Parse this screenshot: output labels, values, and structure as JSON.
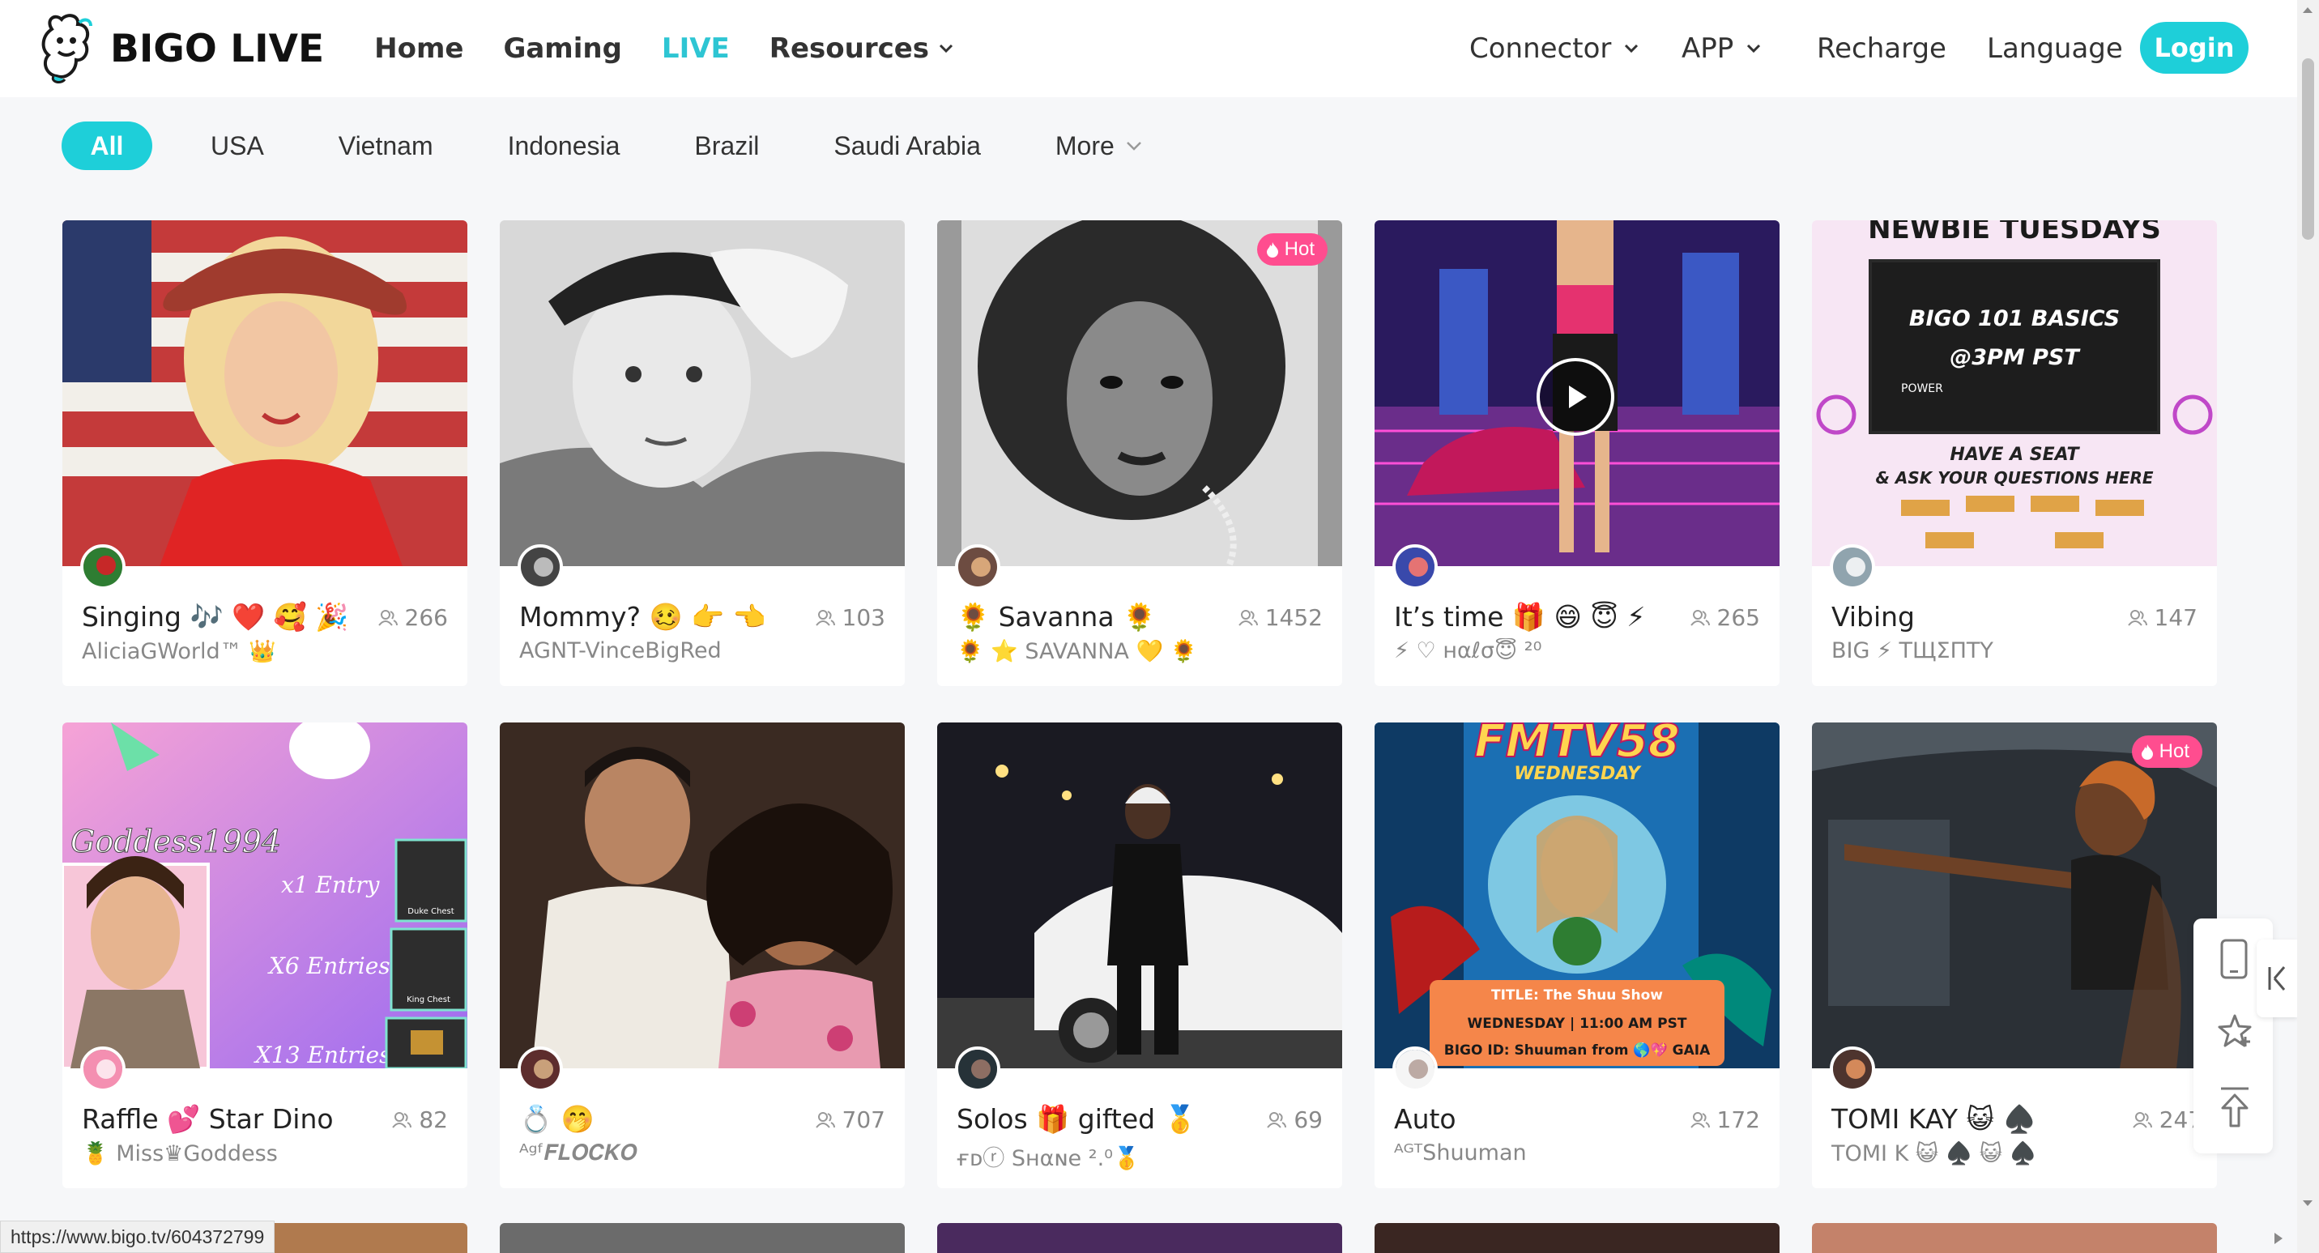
{
  "brand": {
    "name": "BIGO LIVE"
  },
  "nav": {
    "left": [
      {
        "label": "Home"
      },
      {
        "label": "Gaming"
      },
      {
        "label": "LIVE"
      },
      {
        "label": "Resources"
      }
    ],
    "right": [
      {
        "label": "Connector"
      },
      {
        "label": "APP"
      },
      {
        "label": "Recharge"
      },
      {
        "label": "Language"
      }
    ],
    "login": "Login"
  },
  "filters": [
    "All",
    "USA",
    "Vietnam",
    "Indonesia",
    "Brazil",
    "Saudi Arabia",
    "More"
  ],
  "cards": [
    {
      "title": "Singing 🎶 ❤️ 🥰 🎉",
      "sub": "AliciaGWorld™ 👑",
      "viewers": "266",
      "hot": false,
      "play": false
    },
    {
      "title": "Mommy? 🥴 👉 👈",
      "sub": "AGNT-VinceBigRed",
      "viewers": "103",
      "hot": false,
      "play": false
    },
    {
      "title": "🌻 Savanna 🌻",
      "sub": "🌻 ⭐ SAVANNA 💛 🌻",
      "viewers": "1452",
      "hot": true,
      "hot_label": "Hot",
      "play": false
    },
    {
      "title": "It’s time 🎁 😄 😇 ⚡",
      "sub": "⚡ ♡ нαℓσ😇 ²⁰",
      "viewers": "265",
      "hot": false,
      "play": true
    },
    {
      "title": "Vibing",
      "sub": "BIG ⚡ ТЩΣПТΥ",
      "viewers": "147",
      "hot": false,
      "play": false
    },
    {
      "title": "Raffle 💕 Star Dino",
      "sub": "🍍 Miss♛Goddess",
      "viewers": "82",
      "hot": false,
      "play": false
    },
    {
      "title": "💍 🤭",
      "sub": "ᴬᵍᶠ𝑭𝑳𝑶𝑪𝑲𝑶",
      "viewers": "707",
      "hot": false,
      "play": false
    },
    {
      "title": "Solos 🎁 gifted 🥇",
      "sub": "ғᴅⓡ Sнαɴe ².⁰🥇",
      "viewers": "69",
      "hot": false,
      "play": false
    },
    {
      "title": "Auto",
      "sub": "ᴬᴳᵀShuuman",
      "viewers": "172",
      "hot": false,
      "play": false
    },
    {
      "title": "TOMI KAY 😺 ♠️",
      "sub": "TOMI K 😺 ♠️ 😺 ♠️",
      "viewers": "2478",
      "hot": true,
      "hot_label": "Hot",
      "play": false
    }
  ],
  "thumb_text": {
    "newbie_banner": "NEWBIE TUESDAYS",
    "bigo_basics": "BIGO 101 BASICS",
    "time": "@3PM PST",
    "power": "POWER",
    "seat": "HAVE A SEAT",
    "ask": "& ASK YOUR QUESTIONS HERE",
    "goddess": "Goddess1994",
    "x1": "x1 Entry",
    "x6": "X6 Entries",
    "x13": "X13 Entries",
    "duke": "Duke Chest",
    "king": "King Chest",
    "fmtv": "FMTV58",
    "wednesday": "WEDNESDAY",
    "show_title": "TITLE: The Shuu Show",
    "show_time": "WEDNESDAY | 11:00 AM PST",
    "show_id": "BIGO ID: Shuuman from 🌎💖 GAIA"
  },
  "status_url": "https://www.bigo.tv/604372799",
  "colors": {
    "accent": "#1ecfd9",
    "hot": "#ff4d8f"
  }
}
